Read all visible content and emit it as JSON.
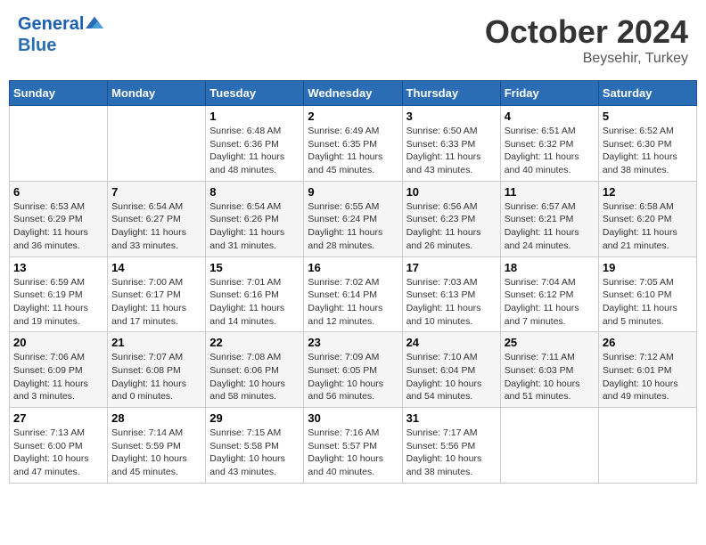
{
  "header": {
    "logo_line1": "General",
    "logo_line2": "Blue",
    "month": "October 2024",
    "location": "Beysehir, Turkey"
  },
  "weekdays": [
    "Sunday",
    "Monday",
    "Tuesday",
    "Wednesday",
    "Thursday",
    "Friday",
    "Saturday"
  ],
  "weeks": [
    [
      {
        "day": "",
        "info": ""
      },
      {
        "day": "",
        "info": ""
      },
      {
        "day": "1",
        "info": "Sunrise: 6:48 AM\nSunset: 6:36 PM\nDaylight: 11 hours and 48 minutes."
      },
      {
        "day": "2",
        "info": "Sunrise: 6:49 AM\nSunset: 6:35 PM\nDaylight: 11 hours and 45 minutes."
      },
      {
        "day": "3",
        "info": "Sunrise: 6:50 AM\nSunset: 6:33 PM\nDaylight: 11 hours and 43 minutes."
      },
      {
        "day": "4",
        "info": "Sunrise: 6:51 AM\nSunset: 6:32 PM\nDaylight: 11 hours and 40 minutes."
      },
      {
        "day": "5",
        "info": "Sunrise: 6:52 AM\nSunset: 6:30 PM\nDaylight: 11 hours and 38 minutes."
      }
    ],
    [
      {
        "day": "6",
        "info": "Sunrise: 6:53 AM\nSunset: 6:29 PM\nDaylight: 11 hours and 36 minutes."
      },
      {
        "day": "7",
        "info": "Sunrise: 6:54 AM\nSunset: 6:27 PM\nDaylight: 11 hours and 33 minutes."
      },
      {
        "day": "8",
        "info": "Sunrise: 6:54 AM\nSunset: 6:26 PM\nDaylight: 11 hours and 31 minutes."
      },
      {
        "day": "9",
        "info": "Sunrise: 6:55 AM\nSunset: 6:24 PM\nDaylight: 11 hours and 28 minutes."
      },
      {
        "day": "10",
        "info": "Sunrise: 6:56 AM\nSunset: 6:23 PM\nDaylight: 11 hours and 26 minutes."
      },
      {
        "day": "11",
        "info": "Sunrise: 6:57 AM\nSunset: 6:21 PM\nDaylight: 11 hours and 24 minutes."
      },
      {
        "day": "12",
        "info": "Sunrise: 6:58 AM\nSunset: 6:20 PM\nDaylight: 11 hours and 21 minutes."
      }
    ],
    [
      {
        "day": "13",
        "info": "Sunrise: 6:59 AM\nSunset: 6:19 PM\nDaylight: 11 hours and 19 minutes."
      },
      {
        "day": "14",
        "info": "Sunrise: 7:00 AM\nSunset: 6:17 PM\nDaylight: 11 hours and 17 minutes."
      },
      {
        "day": "15",
        "info": "Sunrise: 7:01 AM\nSunset: 6:16 PM\nDaylight: 11 hours and 14 minutes."
      },
      {
        "day": "16",
        "info": "Sunrise: 7:02 AM\nSunset: 6:14 PM\nDaylight: 11 hours and 12 minutes."
      },
      {
        "day": "17",
        "info": "Sunrise: 7:03 AM\nSunset: 6:13 PM\nDaylight: 11 hours and 10 minutes."
      },
      {
        "day": "18",
        "info": "Sunrise: 7:04 AM\nSunset: 6:12 PM\nDaylight: 11 hours and 7 minutes."
      },
      {
        "day": "19",
        "info": "Sunrise: 7:05 AM\nSunset: 6:10 PM\nDaylight: 11 hours and 5 minutes."
      }
    ],
    [
      {
        "day": "20",
        "info": "Sunrise: 7:06 AM\nSunset: 6:09 PM\nDaylight: 11 hours and 3 minutes."
      },
      {
        "day": "21",
        "info": "Sunrise: 7:07 AM\nSunset: 6:08 PM\nDaylight: 11 hours and 0 minutes."
      },
      {
        "day": "22",
        "info": "Sunrise: 7:08 AM\nSunset: 6:06 PM\nDaylight: 10 hours and 58 minutes."
      },
      {
        "day": "23",
        "info": "Sunrise: 7:09 AM\nSunset: 6:05 PM\nDaylight: 10 hours and 56 minutes."
      },
      {
        "day": "24",
        "info": "Sunrise: 7:10 AM\nSunset: 6:04 PM\nDaylight: 10 hours and 54 minutes."
      },
      {
        "day": "25",
        "info": "Sunrise: 7:11 AM\nSunset: 6:03 PM\nDaylight: 10 hours and 51 minutes."
      },
      {
        "day": "26",
        "info": "Sunrise: 7:12 AM\nSunset: 6:01 PM\nDaylight: 10 hours and 49 minutes."
      }
    ],
    [
      {
        "day": "27",
        "info": "Sunrise: 7:13 AM\nSunset: 6:00 PM\nDaylight: 10 hours and 47 minutes."
      },
      {
        "day": "28",
        "info": "Sunrise: 7:14 AM\nSunset: 5:59 PM\nDaylight: 10 hours and 45 minutes."
      },
      {
        "day": "29",
        "info": "Sunrise: 7:15 AM\nSunset: 5:58 PM\nDaylight: 10 hours and 43 minutes."
      },
      {
        "day": "30",
        "info": "Sunrise: 7:16 AM\nSunset: 5:57 PM\nDaylight: 10 hours and 40 minutes."
      },
      {
        "day": "31",
        "info": "Sunrise: 7:17 AM\nSunset: 5:56 PM\nDaylight: 10 hours and 38 minutes."
      },
      {
        "day": "",
        "info": ""
      },
      {
        "day": "",
        "info": ""
      }
    ]
  ]
}
